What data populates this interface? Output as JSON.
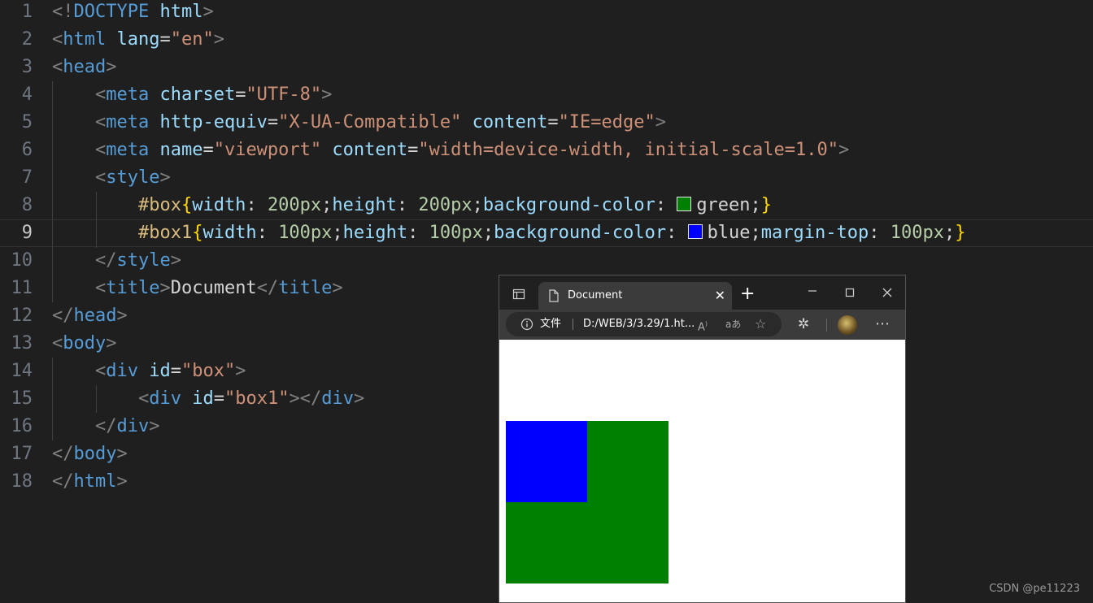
{
  "editor": {
    "line_numbers": [
      "1",
      "2",
      "3",
      "4",
      "5",
      "6",
      "7",
      "8",
      "9",
      "10",
      "11",
      "12",
      "13",
      "14",
      "15",
      "16",
      "17",
      "18"
    ],
    "lines": [
      [
        [
          "br",
          "<!"
        ],
        [
          "tag",
          "DOCTYPE"
        ],
        [
          "txt",
          " "
        ],
        [
          "attr",
          "html"
        ],
        [
          "br",
          ">"
        ]
      ],
      [
        [
          "br",
          "<"
        ],
        [
          "tag",
          "html"
        ],
        [
          "txt",
          " "
        ],
        [
          "attr",
          "lang"
        ],
        [
          "txt",
          "="
        ],
        [
          "str",
          "\"en\""
        ],
        [
          "br",
          ">"
        ]
      ],
      [
        [
          "br",
          "<"
        ],
        [
          "tag",
          "head"
        ],
        [
          "br",
          ">"
        ]
      ],
      [
        [
          "txt",
          "    "
        ],
        [
          "br",
          "<"
        ],
        [
          "tag",
          "meta"
        ],
        [
          "txt",
          " "
        ],
        [
          "attr",
          "charset"
        ],
        [
          "txt",
          "="
        ],
        [
          "str",
          "\"UTF-8\""
        ],
        [
          "br",
          ">"
        ]
      ],
      [
        [
          "txt",
          "    "
        ],
        [
          "br",
          "<"
        ],
        [
          "tag",
          "meta"
        ],
        [
          "txt",
          " "
        ],
        [
          "attr",
          "http-equiv"
        ],
        [
          "txt",
          "="
        ],
        [
          "str",
          "\"X-UA-Compatible\""
        ],
        [
          "txt",
          " "
        ],
        [
          "attr",
          "content"
        ],
        [
          "txt",
          "="
        ],
        [
          "str",
          "\"IE=edge\""
        ],
        [
          "br",
          ">"
        ]
      ],
      [
        [
          "txt",
          "    "
        ],
        [
          "br",
          "<"
        ],
        [
          "tag",
          "meta"
        ],
        [
          "txt",
          " "
        ],
        [
          "attr",
          "name"
        ],
        [
          "txt",
          "="
        ],
        [
          "str",
          "\"viewport\""
        ],
        [
          "txt",
          " "
        ],
        [
          "attr",
          "content"
        ],
        [
          "txt",
          "="
        ],
        [
          "str",
          "\"width=device-width, initial-scale=1.0\""
        ],
        [
          "br",
          ">"
        ]
      ],
      [
        [
          "txt",
          "    "
        ],
        [
          "br",
          "<"
        ],
        [
          "tag",
          "style"
        ],
        [
          "br",
          ">"
        ]
      ],
      [
        [
          "txt",
          "        "
        ],
        [
          "sel",
          "#box"
        ],
        [
          "brace",
          "{"
        ],
        [
          "prop",
          "width"
        ],
        [
          "txt",
          ": "
        ],
        [
          "num",
          "200px"
        ],
        [
          "txt",
          ";"
        ],
        [
          "prop",
          "height"
        ],
        [
          "txt",
          ": "
        ],
        [
          "num",
          "200px"
        ],
        [
          "txt",
          ";"
        ],
        [
          "prop",
          "background-color"
        ],
        [
          "txt",
          ": "
        ],
        [
          "swatch",
          "#008000"
        ],
        [
          "txt",
          "green;"
        ],
        [
          "brace",
          "}"
        ]
      ],
      [
        [
          "txt",
          "        "
        ],
        [
          "sel",
          "#box1"
        ],
        [
          "brace",
          "{"
        ],
        [
          "prop",
          "width"
        ],
        [
          "txt",
          ": "
        ],
        [
          "num",
          "100px"
        ],
        [
          "txt",
          ";"
        ],
        [
          "prop",
          "height"
        ],
        [
          "txt",
          ": "
        ],
        [
          "num",
          "100px"
        ],
        [
          "txt",
          ";"
        ],
        [
          "prop",
          "background-color"
        ],
        [
          "txt",
          ": "
        ],
        [
          "swatch",
          "#0000ff"
        ],
        [
          "txt",
          "blue;"
        ],
        [
          "prop",
          "margin-top"
        ],
        [
          "txt",
          ": "
        ],
        [
          "num",
          "100px"
        ],
        [
          "txt",
          ";"
        ],
        [
          "brace",
          "}"
        ]
      ],
      [
        [
          "txt",
          "    "
        ],
        [
          "br",
          "</"
        ],
        [
          "tag",
          "style"
        ],
        [
          "br",
          ">"
        ]
      ],
      [
        [
          "txt",
          "    "
        ],
        [
          "br",
          "<"
        ],
        [
          "tag",
          "title"
        ],
        [
          "br",
          ">"
        ],
        [
          "txt",
          "Document"
        ],
        [
          "br",
          "</"
        ],
        [
          "tag",
          "title"
        ],
        [
          "br",
          ">"
        ]
      ],
      [
        [
          "br",
          "</"
        ],
        [
          "tag",
          "head"
        ],
        [
          "br",
          ">"
        ]
      ],
      [
        [
          "br",
          "<"
        ],
        [
          "tag",
          "body"
        ],
        [
          "br",
          ">"
        ]
      ],
      [
        [
          "txt",
          "    "
        ],
        [
          "br",
          "<"
        ],
        [
          "tag",
          "div"
        ],
        [
          "txt",
          " "
        ],
        [
          "attr",
          "id"
        ],
        [
          "txt",
          "="
        ],
        [
          "str",
          "\"box\""
        ],
        [
          "br",
          ">"
        ]
      ],
      [
        [
          "txt",
          "        "
        ],
        [
          "br",
          "<"
        ],
        [
          "tag",
          "div"
        ],
        [
          "txt",
          " "
        ],
        [
          "attr",
          "id"
        ],
        [
          "txt",
          "="
        ],
        [
          "str",
          "\"box1\""
        ],
        [
          "br",
          "></"
        ],
        [
          "tag",
          "div"
        ],
        [
          "br",
          ">"
        ]
      ],
      [
        [
          "txt",
          "    "
        ],
        [
          "br",
          "</"
        ],
        [
          "tag",
          "div"
        ],
        [
          "br",
          ">"
        ]
      ],
      [
        [
          "br",
          "</"
        ],
        [
          "tag",
          "body"
        ],
        [
          "br",
          ">"
        ]
      ],
      [
        [
          "br",
          "</"
        ],
        [
          "tag",
          "html"
        ],
        [
          "br",
          ">"
        ]
      ]
    ],
    "current_line": 9
  },
  "browser": {
    "tab_title": "Document",
    "address_info": "文件",
    "address_url": "D:/WEB/3/3.29/1.ht...",
    "icons": {
      "tab_actions": "tab-actions-icon",
      "page": "page-icon",
      "close_tab": "close-icon",
      "new_tab": "plus-icon",
      "minimize": "minimize-icon",
      "maximize": "maximize-icon",
      "close_window": "close-icon",
      "info": "info-icon",
      "read_aloud": "read-aloud-icon",
      "translate": "translate-icon",
      "favorite": "favorite-add-icon",
      "extensions": "extensions-icon",
      "profile": "avatar",
      "more": "more-icon"
    },
    "rendered": {
      "box_color": "#008000",
      "box1_color": "#0000ff"
    }
  },
  "watermark": "CSDN @pe11223"
}
